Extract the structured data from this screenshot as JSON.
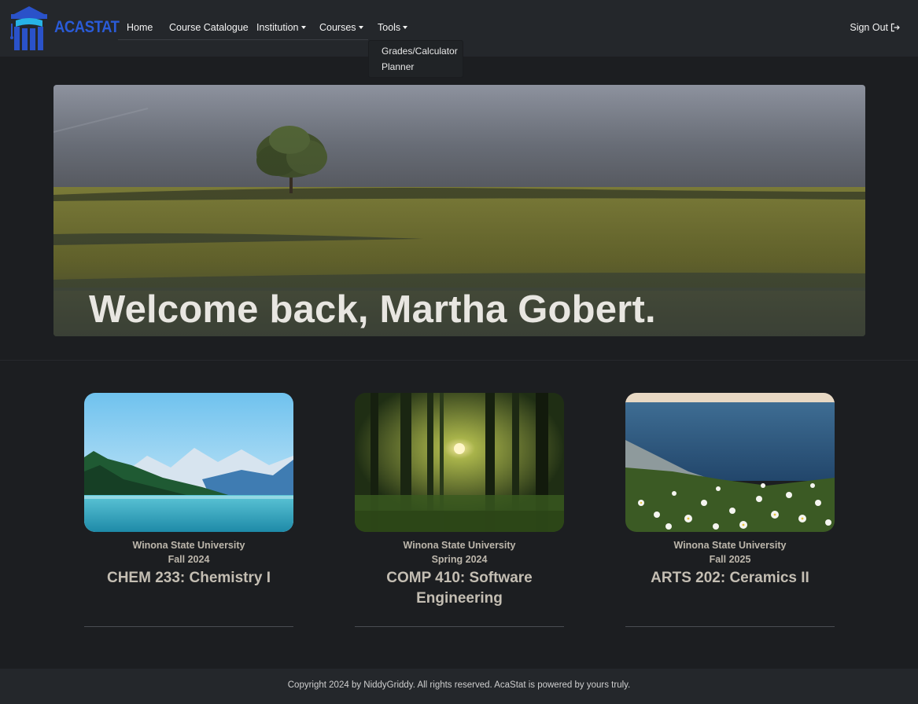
{
  "app": {
    "brand": "ACASTAT",
    "logo_icon": "academic-cap-columns-icon"
  },
  "nav": {
    "home": "Home",
    "catalogue": "Course Catalogue",
    "institution": "Institution",
    "courses": "Courses",
    "tools": "Tools",
    "signout": "Sign Out",
    "signout_icon": "sign-out-icon"
  },
  "tools_menu": {
    "items": [
      "Grades/Calculator",
      "Planner"
    ]
  },
  "hero": {
    "greeting": "Welcome back, Martha Gobert.",
    "image": "field-with-lone-tree"
  },
  "courses": [
    {
      "institution": "Winona State University",
      "term": "Fall 2024",
      "title": "CHEM 233: Chemistry I",
      "image": "mountain-lake"
    },
    {
      "institution": "Winona State University",
      "term": "Spring 2024",
      "title": "COMP 410: Software Engineering",
      "image": "sunlit-forest"
    },
    {
      "institution": "Winona State University",
      "term": "Fall 2025",
      "title": "ARTS 202: Ceramics II",
      "image": "coast-daisies"
    }
  ],
  "footer": {
    "text": "Copyright 2024 by NiddyGriddy. All rights reserved. AcaStat is powered by yours truly."
  },
  "colors": {
    "background": "#1c1e21",
    "navbar": "#24272b",
    "brand": "#2a5bd7",
    "logo_accent": "#27b3e6"
  }
}
